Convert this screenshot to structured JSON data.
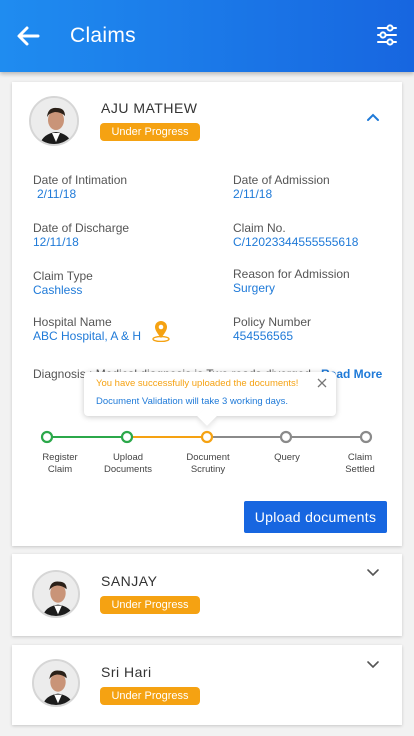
{
  "app": {
    "title": "Claims"
  },
  "claims": [
    {
      "name": "AJU MATHEW",
      "status": "Under Progress",
      "fields": {
        "date_of_intimation": {
          "label": "Date of Intimation",
          "value": "2/11/18"
        },
        "date_of_admission": {
          "label": "Date of Admission",
          "value": "2/11/18"
        },
        "date_of_discharge": {
          "label": "Date of Discharge",
          "value": "12/11/18"
        },
        "claim_no": {
          "label": "Claim No.",
          "value": "C/12023344555555618"
        },
        "claim_type": {
          "label": "Claim Type",
          "value": "Cashless"
        },
        "reason_for_admission": {
          "label": "Reason for Admission",
          "value": "Surgery"
        },
        "hospital_name": {
          "label": "Hospital Name",
          "value": "ABC Hospital, A & H"
        },
        "policy_number": {
          "label": "Policy Number",
          "value": "454556565"
        }
      },
      "diagnosis": "Diagnosis : Medical diagnosis is Two roads diverged",
      "read_more": "Read More",
      "tooltip": {
        "line1": "You have successfully uploaded the documents!",
        "line2": "Document Validation will take 3 working days."
      },
      "steps": [
        {
          "label_1": "Register",
          "label_2": "Claim",
          "state": "done"
        },
        {
          "label_1": "Upload",
          "label_2": "Documents",
          "state": "done"
        },
        {
          "label_1": "Document",
          "label_2": "Scrutiny",
          "state": "current"
        },
        {
          "label_1": "Query",
          "label_2": "",
          "state": "pending"
        },
        {
          "label_1": "Claim",
          "label_2": "Settled",
          "state": "pending"
        }
      ],
      "upload_button": "Upload documents"
    },
    {
      "name": "SANJAY",
      "status": "Under Progress"
    },
    {
      "name": "Sri Hari",
      "status": "Under Progress"
    }
  ],
  "colors": {
    "primary": "#1766e0",
    "badge": "#f5a212",
    "done": "#2ba84a",
    "current": "#f5a212",
    "pending": "#8a8a8a"
  },
  "icons": {
    "back": "arrow-left-icon",
    "filter": "sliders-icon",
    "expand": "chevron-icon",
    "location": "map-pin-icon",
    "close": "close-icon"
  }
}
